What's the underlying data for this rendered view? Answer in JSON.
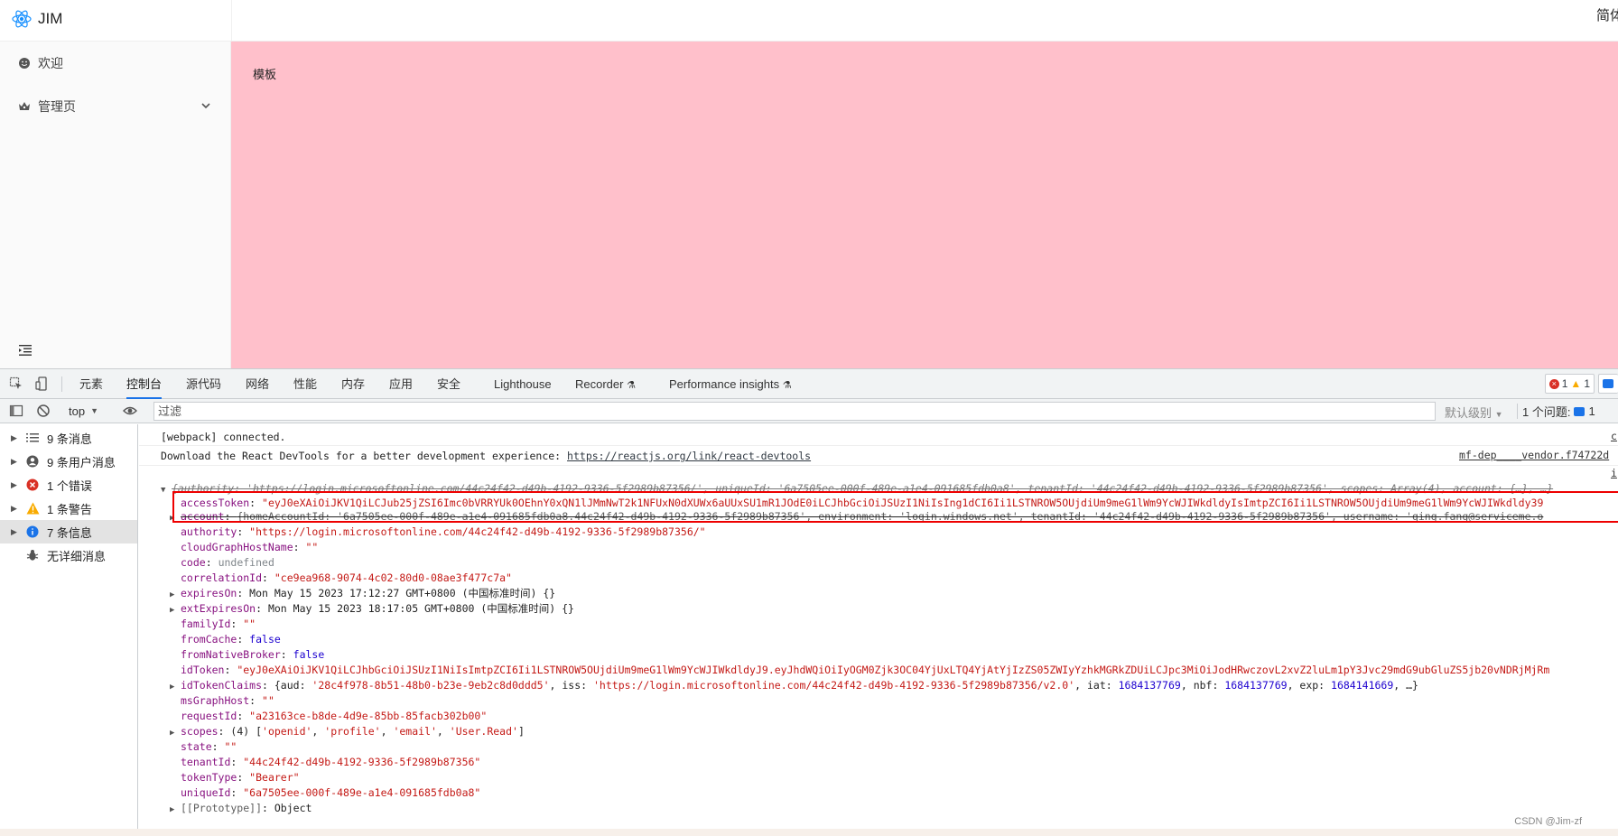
{
  "app": {
    "logo_text": "JIM",
    "lang_text": "简体",
    "menu": [
      {
        "label": "欢迎",
        "icon": "smile-icon"
      },
      {
        "label": "管理页",
        "icon": "crown-icon"
      }
    ],
    "content_title": "模板"
  },
  "devtools": {
    "tabs": [
      "元素",
      "控制台",
      "源代码",
      "网络",
      "性能",
      "内存",
      "应用",
      "安全",
      "Lighthouse",
      "Recorder",
      "Performance insights"
    ],
    "active_tab": "控制台",
    "badges": {
      "errors": "1",
      "warnings": "1"
    },
    "toolbar": {
      "context": "top",
      "filter_placeholder": "过滤",
      "levels": "默认级别",
      "issues_label": "1 个问题:",
      "issues_count": "1"
    },
    "sidebar": [
      {
        "label": "9 条消息",
        "icon": "list-icon"
      },
      {
        "label": "9 条用户消息",
        "icon": "user-icon"
      },
      {
        "label": "1 个错误",
        "icon": "error-icon"
      },
      {
        "label": "1 条警告",
        "icon": "warning-icon"
      },
      {
        "label": "7 条信息",
        "icon": "info-icon"
      },
      {
        "label": "无详细消息",
        "icon": "bug-icon"
      }
    ],
    "console": {
      "line1": "[webpack] connected.",
      "line1_src": "c",
      "line2_text": "Download the React DevTools for a better development experience: ",
      "line2_url": "https://reactjs.org/link/react-devtools",
      "line2_src": "mf-dep____vendor.f74722d",
      "line3_src": "i",
      "summary": "{authority: 'https://login.microsoftonline.com/44c24f42-d49b-4192-9336-5f2989b87356/', uniqueId: '6a7505ee-000f-489e-a1e4-091685fdb0a8', tenantId: '44c24f42-d49b-4192-9336-5f2989b87356', scopes: Array(4), account: {…}, …}",
      "accessToken_key": "accessToken",
      "accessToken_val": "\"eyJ0eXAiOiJKV1QiLCJub25jZSI6Imc0bVRRYUk0OEhnY0xQN1lJMmNwT2k1NFUxN0dXUWx6aUUxSU1mR1JOdE0iLCJhbGciOiJSUzI1NiIsIng1dCI6Ii1LSTNROW5OUjdiUm9meG1lWm9YcWJIWkdldyIsImtpZCI6Ii1LSTNROW5OUjdiUm9meG1lWm9YcWJIWkdldy39",
      "account_key": "account",
      "account_val": "{homeAccountId: '6a7505ee-000f-489e-a1e4-091685fdb0a8.44c24f42-d49b-4192-9336-5f2989b87356', environment: 'login.windows.net', tenantId: '44c24f42-d49b-4192-9336-5f2989b87356', username: 'qing.fang@serviceme.o",
      "authority_key": "authority",
      "authority_val": "\"https://login.microsoftonline.com/44c24f42-d49b-4192-9336-5f2989b87356/\"",
      "cloudGraph_key": "cloudGraphHostName",
      "cloudGraph_val": "\"\"",
      "code_key": "code",
      "code_val": "undefined",
      "correlation_key": "correlationId",
      "correlation_val": "\"ce9ea968-9074-4c02-80d0-08ae3f477c7a\"",
      "expiresOn_key": "expiresOn",
      "expiresOn_val": "Mon May 15 2023 17:12:27 GMT+0800 (中国标准时间) {}",
      "extExpiresOn_key": "extExpiresOn",
      "extExpiresOn_val": "Mon May 15 2023 18:17:05 GMT+0800 (中国标准时间) {}",
      "familyId_key": "familyId",
      "familyId_val": "\"\"",
      "fromCache_key": "fromCache",
      "fromCache_val": "false",
      "fromNative_key": "fromNativeBroker",
      "fromNative_val": "false",
      "idToken_key": "idToken",
      "idToken_val": "\"eyJ0eXAiOiJKV1QiLCJhbGciOiJSUzI1NiIsImtpZCI6Ii1LSTNROW5OUjdiUm9meG1lWm9YcWJIWkdldyJ9.eyJhdWQiOiIyOGM0Zjk3OC04YjUxLTQ4YjAtYjIzZS05ZWIyYzhkMGRkZDUiLCJpc3MiOiJodHRwczovL2xvZ2luLm1pY3Jvc29mdG9ubGluZS5jb20vNDRjMjRm",
      "idTokenClaims_key": "idTokenClaims",
      "idTokenClaims_a": "{aud: ",
      "idTokenClaims_aud": "'28c4f978-8b51-48b0-b23e-9eb2c8d0ddd5'",
      "idTokenClaims_b": ", iss: ",
      "idTokenClaims_iss": "'https://login.microsoftonline.com/44c24f42-d49b-4192-9336-5f2989b87356/v2.0'",
      "idTokenClaims_c": ", iat: ",
      "idTokenClaims_iat": "1684137769",
      "idTokenClaims_d": ", nbf: ",
      "idTokenClaims_nbf": "1684137769",
      "idTokenClaims_e": ", exp: ",
      "idTokenClaims_exp": "1684141669",
      "idTokenClaims_f": ", …}",
      "msGraph_key": "msGraphHost",
      "msGraph_val": "\"\"",
      "requestId_key": "requestId",
      "requestId_val": "\"a23163ce-b8de-4d9e-85bb-85facb302b00\"",
      "scopes_key": "scopes",
      "scopes_a": "(4) [",
      "scopes_v1": "'openid'",
      "scopes_v2": "'profile'",
      "scopes_v3": "'email'",
      "scopes_v4": "'User.Read'",
      "scopes_z": "]",
      "state_key": "state",
      "state_val": "\"\"",
      "tenantId_key": "tenantId",
      "tenantId_val": "\"44c24f42-d49b-4192-9336-5f2989b87356\"",
      "tokenType_key": "tokenType",
      "tokenType_val": "\"Bearer\"",
      "uniqueId_key": "uniqueId",
      "uniqueId_val": "\"6a7505ee-000f-489e-a1e4-091685fdb0a8\"",
      "proto_key": "[[Prototype]]",
      "proto_val": "Object"
    }
  },
  "watermark": "CSDN @Jim-zf"
}
